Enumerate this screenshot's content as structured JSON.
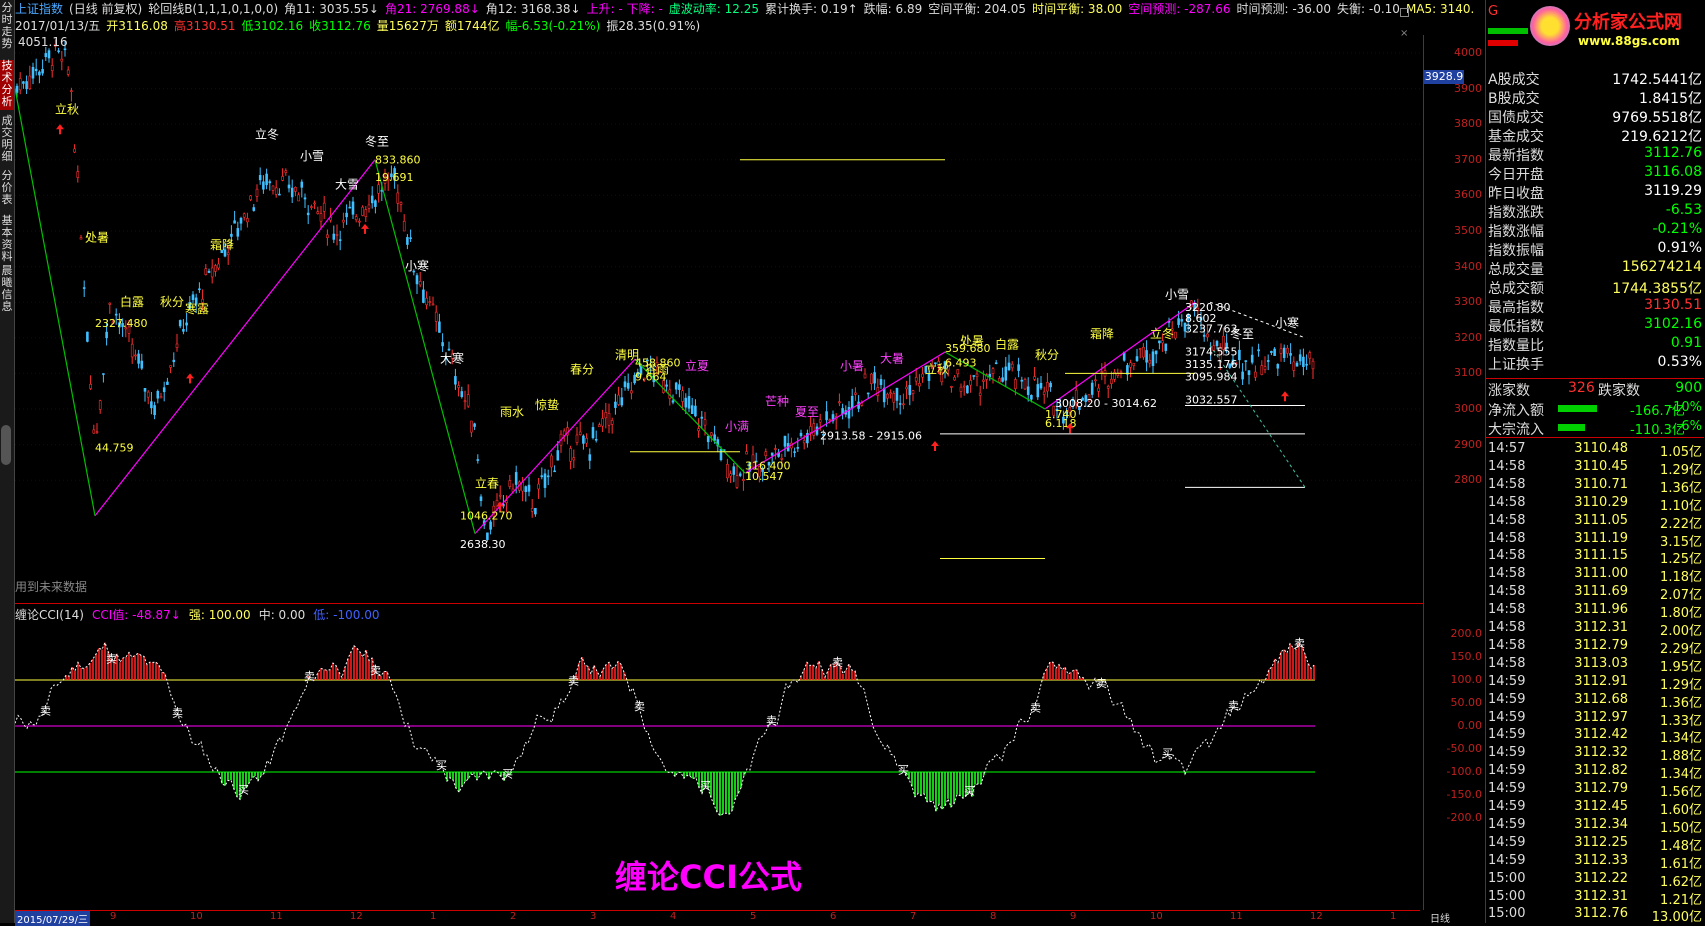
{
  "left_tabs": [
    {
      "label": "分时走势",
      "active": false
    },
    {
      "label": "技术分析",
      "active": true
    },
    {
      "label": "成交明细",
      "active": false
    },
    {
      "label": "分价表",
      "active": false
    },
    {
      "label": "基本资料",
      "active": false
    },
    {
      "label": "晨曦信息",
      "active": false
    }
  ],
  "header": {
    "index_name": "上证指数",
    "mode": "(日线 前复权)",
    "indicator_params": "轮回线B(1,1,1,0,1,0,0)",
    "angle11": "角11: 3035.55↓",
    "angle21": "角21: 2769.88↓",
    "angle12": "角12: 3168.38↓",
    "up_down": "上升: -  下降: -",
    "wave_energy": "虚波动率: 12.25",
    "cum_turnover": "累计换手: 0.19↑",
    "drop_amp": "跌幅: 6.89",
    "space_balance": "空间平衡: 204.05",
    "time_balance": "时间平衡: 38.00",
    "space_predict": "空间预测: -287.66",
    "time_predict": "时间预测: -36.00",
    "loss": "失衡: -0.10",
    "ma5": "MA5: 3140.",
    "date": "2017/01/13/五",
    "open": "开3116.08",
    "high": "高3130.51",
    "low": "低3102.16",
    "close": "收3112.76",
    "volume": "量15627万",
    "amount": "额1744亿",
    "change": "幅-6.53(-0.21%)",
    "swing": "振28.35(0.91%)"
  },
  "chart_labels": {
    "top_left_value": "4051.16",
    "future_data_note": "用到未来数据",
    "price_tag": "3928.9"
  },
  "price_ticks": [
    "4000",
    "3900",
    "3800",
    "3700",
    "3600",
    "3500",
    "3400",
    "3300",
    "3200",
    "3100",
    "3000",
    "2900",
    "2800"
  ],
  "solar_terms": [
    {
      "t": "立秋",
      "c": "y"
    },
    {
      "t": "处暑",
      "c": "y"
    },
    {
      "t": "白露",
      "c": "y"
    },
    {
      "t": "秋分",
      "c": "y"
    },
    {
      "t": "寒露",
      "c": "y"
    },
    {
      "t": "霜降",
      "c": "y"
    },
    {
      "t": "立冬",
      "c": "w"
    },
    {
      "t": "小雪",
      "c": "w"
    },
    {
      "t": "冬至",
      "c": "w"
    },
    {
      "t": "大雪",
      "c": "w"
    },
    {
      "t": "小寒",
      "c": "w"
    },
    {
      "t": "大寒",
      "c": "w"
    },
    {
      "t": "立春",
      "c": "y"
    },
    {
      "t": "雨水",
      "c": "y"
    },
    {
      "t": "惊蛰",
      "c": "y"
    },
    {
      "t": "春分",
      "c": "y"
    },
    {
      "t": "清明",
      "c": "y"
    },
    {
      "t": "谷雨",
      "c": "y"
    },
    {
      "t": "立夏",
      "c": "m"
    },
    {
      "t": "小满",
      "c": "m"
    },
    {
      "t": "芒种",
      "c": "m"
    },
    {
      "t": "夏至",
      "c": "m"
    },
    {
      "t": "小暑",
      "c": "m"
    },
    {
      "t": "大暑",
      "c": "m"
    },
    {
      "t": "立秋",
      "c": "y"
    },
    {
      "t": "处暑",
      "c": "y"
    },
    {
      "t": "白露",
      "c": "y"
    },
    {
      "t": "秋分",
      "c": "y"
    },
    {
      "t": "霜降",
      "c": "y"
    },
    {
      "t": "立冬",
      "c": "y"
    },
    {
      "t": "小雪",
      "c": "w"
    },
    {
      "t": "冬至",
      "c": "w"
    },
    {
      "t": "小寒",
      "c": "w"
    }
  ],
  "price_annotations": [
    {
      "t": "44.759",
      "c": "y"
    },
    {
      "t": "2327.480",
      "c": "y"
    },
    {
      "t": "833.860",
      "c": "y"
    },
    {
      "t": "19.691",
      "c": "y"
    },
    {
      "t": "1046.270",
      "c": "y"
    },
    {
      "t": "2638.30",
      "c": "w"
    },
    {
      "t": "458.860",
      "c": "y"
    },
    {
      "t": "9.664",
      "c": "y"
    },
    {
      "t": "316.400",
      "c": "y"
    },
    {
      "t": "10.547",
      "c": "y"
    },
    {
      "t": "2913.58 - 2915.06",
      "c": "w"
    },
    {
      "t": "359.680",
      "c": "y"
    },
    {
      "t": "6.493",
      "c": "y"
    },
    {
      "t": "3008.20 - 3014.62",
      "c": "w"
    },
    {
      "t": "1.740",
      "c": "y"
    },
    {
      "t": "6.118",
      "c": "y"
    },
    {
      "t": "3220.80",
      "c": "w"
    },
    {
      "t": "8.602",
      "c": "w"
    },
    {
      "t": "3237.763",
      "c": "w"
    },
    {
      "t": "3174.555",
      "c": "w"
    },
    {
      "t": "3135.176",
      "c": "w"
    },
    {
      "t": "3095.984",
      "c": "w"
    },
    {
      "t": "3032.557",
      "c": "w"
    }
  ],
  "cci": {
    "title": "缠论CCI(14)",
    "value": "CCI值: -48.87↓",
    "strong": "强: 100.00",
    "mid": "中: 0.00",
    "weak": "低: -100.00",
    "ticks": [
      "200.0",
      "150.0",
      "100.0",
      "50.00",
      "0.00",
      "-50.00",
      "-100.0",
      "-150.0",
      "-200.0"
    ],
    "buy_label": "买",
    "sell_label": "卖"
  },
  "watermark": "缠论CCI公式",
  "bottom_axis": {
    "start_date": "2015/07/29/三",
    "labels": [
      "9",
      "10",
      "11",
      "12",
      "1",
      "2",
      "3",
      "4",
      "5",
      "6",
      "7",
      "8",
      "9",
      "10",
      "11",
      "12",
      "1"
    ],
    "right": "日线"
  },
  "right_panel": {
    "logo_text": "分析家公式网",
    "logo_url": "www.88gs.com",
    "stats": [
      {
        "label": "A股成交",
        "value": "1742.5441亿",
        "color": "#ffffff"
      },
      {
        "label": "B股成交",
        "value": "1.8415亿",
        "color": "#ffffff"
      },
      {
        "label": "国债成交",
        "value": "9769.5518亿",
        "color": "#ffffff"
      },
      {
        "label": "基金成交",
        "value": "219.6212亿",
        "color": "#ffffff"
      },
      {
        "label": "最新指数",
        "value": "3112.76",
        "color": "#00ff00"
      },
      {
        "label": "今日开盘",
        "value": "3116.08",
        "color": "#00ff00"
      },
      {
        "label": "昨日收盘",
        "value": "3119.29",
        "color": "#ffffff"
      },
      {
        "label": "指数涨跌",
        "value": "-6.53",
        "color": "#00ff00"
      },
      {
        "label": "指数涨幅",
        "value": "-0.21%",
        "color": "#00ff00"
      },
      {
        "label": "指数振幅",
        "value": "0.91%",
        "color": "#ffffff"
      },
      {
        "label": "总成交量",
        "value": "156274214",
        "color": "#ffff60"
      },
      {
        "label": "总成交额",
        "value": "1744.3855亿",
        "color": "#ffff60"
      },
      {
        "label": "最高指数",
        "value": "3130.51",
        "color": "#ff3030"
      },
      {
        "label": "最低指数",
        "value": "3102.16",
        "color": "#00ff00"
      },
      {
        "label": "指数量比",
        "value": "0.91",
        "color": "#00ff00"
      },
      {
        "label": "上证换手",
        "value": "0.53%",
        "color": "#ffffff"
      }
    ],
    "updown": {
      "up_label": "涨家数",
      "up": "326",
      "down_label": "跌家数",
      "down": "900"
    },
    "flows": [
      {
        "label": "净流入额",
        "value": "-166.7亿",
        "pct": "-10%",
        "bar": 0.55
      },
      {
        "label": "大宗流入",
        "value": "-110.3亿",
        "pct": "-6%",
        "bar": 0.38
      }
    ],
    "ticks": [
      {
        "t": "14:57",
        "p": "3110.48",
        "v": "1.05亿"
      },
      {
        "t": "14:58",
        "p": "3110.45",
        "v": "1.29亿"
      },
      {
        "t": "14:58",
        "p": "3110.71",
        "v": "1.36亿"
      },
      {
        "t": "14:58",
        "p": "3110.29",
        "v": "1.10亿"
      },
      {
        "t": "14:58",
        "p": "3111.05",
        "v": "2.22亿"
      },
      {
        "t": "14:58",
        "p": "3111.19",
        "v": "3.15亿"
      },
      {
        "t": "14:58",
        "p": "3111.15",
        "v": "1.25亿"
      },
      {
        "t": "14:58",
        "p": "3111.00",
        "v": "1.18亿"
      },
      {
        "t": "14:58",
        "p": "3111.69",
        "v": "2.07亿"
      },
      {
        "t": "14:58",
        "p": "3111.96",
        "v": "1.80亿"
      },
      {
        "t": "14:58",
        "p": "3112.31",
        "v": "2.00亿"
      },
      {
        "t": "14:58",
        "p": "3112.79",
        "v": "2.29亿"
      },
      {
        "t": "14:58",
        "p": "3113.03",
        "v": "1.95亿"
      },
      {
        "t": "14:59",
        "p": "3112.91",
        "v": "1.29亿"
      },
      {
        "t": "14:59",
        "p": "3112.68",
        "v": "1.36亿"
      },
      {
        "t": "14:59",
        "p": "3112.97",
        "v": "1.33亿"
      },
      {
        "t": "14:59",
        "p": "3112.42",
        "v": "1.34亿"
      },
      {
        "t": "14:59",
        "p": "3112.32",
        "v": "1.88亿"
      },
      {
        "t": "14:59",
        "p": "3112.82",
        "v": "1.34亿"
      },
      {
        "t": "14:59",
        "p": "3112.79",
        "v": "1.56亿"
      },
      {
        "t": "14:59",
        "p": "3112.45",
        "v": "1.60亿"
      },
      {
        "t": "14:59",
        "p": "3112.34",
        "v": "1.50亿"
      },
      {
        "t": "14:59",
        "p": "3112.25",
        "v": "1.48亿"
      },
      {
        "t": "14:59",
        "p": "3112.33",
        "v": "1.61亿"
      },
      {
        "t": "15:00",
        "p": "3112.22",
        "v": "1.62亿"
      },
      {
        "t": "15:00",
        "p": "3112.31",
        "v": "1.21亿"
      },
      {
        "t": "15:00",
        "p": "3112.76",
        "v": "13.00亿"
      }
    ]
  }
}
